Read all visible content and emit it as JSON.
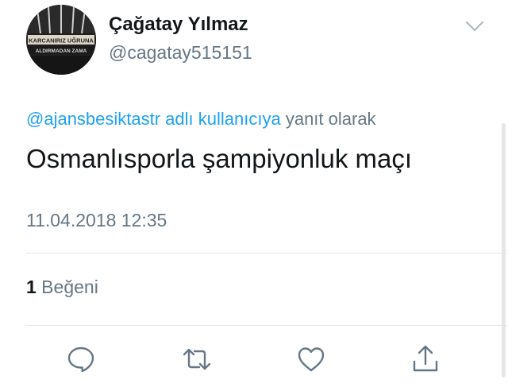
{
  "user": {
    "display_name": "Çağatay Yılmaz",
    "handle": "@cagatay515151",
    "avatar_banner_line1": "KARCANIRIZ UĞRUNA",
    "avatar_banner_line2": "ALDIRMADAN ZAMA"
  },
  "tweet": {
    "reply_to_link": "@ajansbesiktastr adlı kullanıcıya",
    "reply_suffix": " yanıt olarak",
    "text": "Osmanlısporla şampiyonluk maçı",
    "timestamp": "11.04.2018 12:35"
  },
  "stats": {
    "like_count": "1",
    "like_label": " Beğeni"
  },
  "actions": {
    "icons": [
      "reply-icon",
      "retweet-icon",
      "like-icon",
      "share-icon"
    ]
  },
  "colors": {
    "link": "#1da1f2",
    "secondary_text": "#657786",
    "primary_text": "#14171a",
    "divider": "#e1e8ed"
  }
}
